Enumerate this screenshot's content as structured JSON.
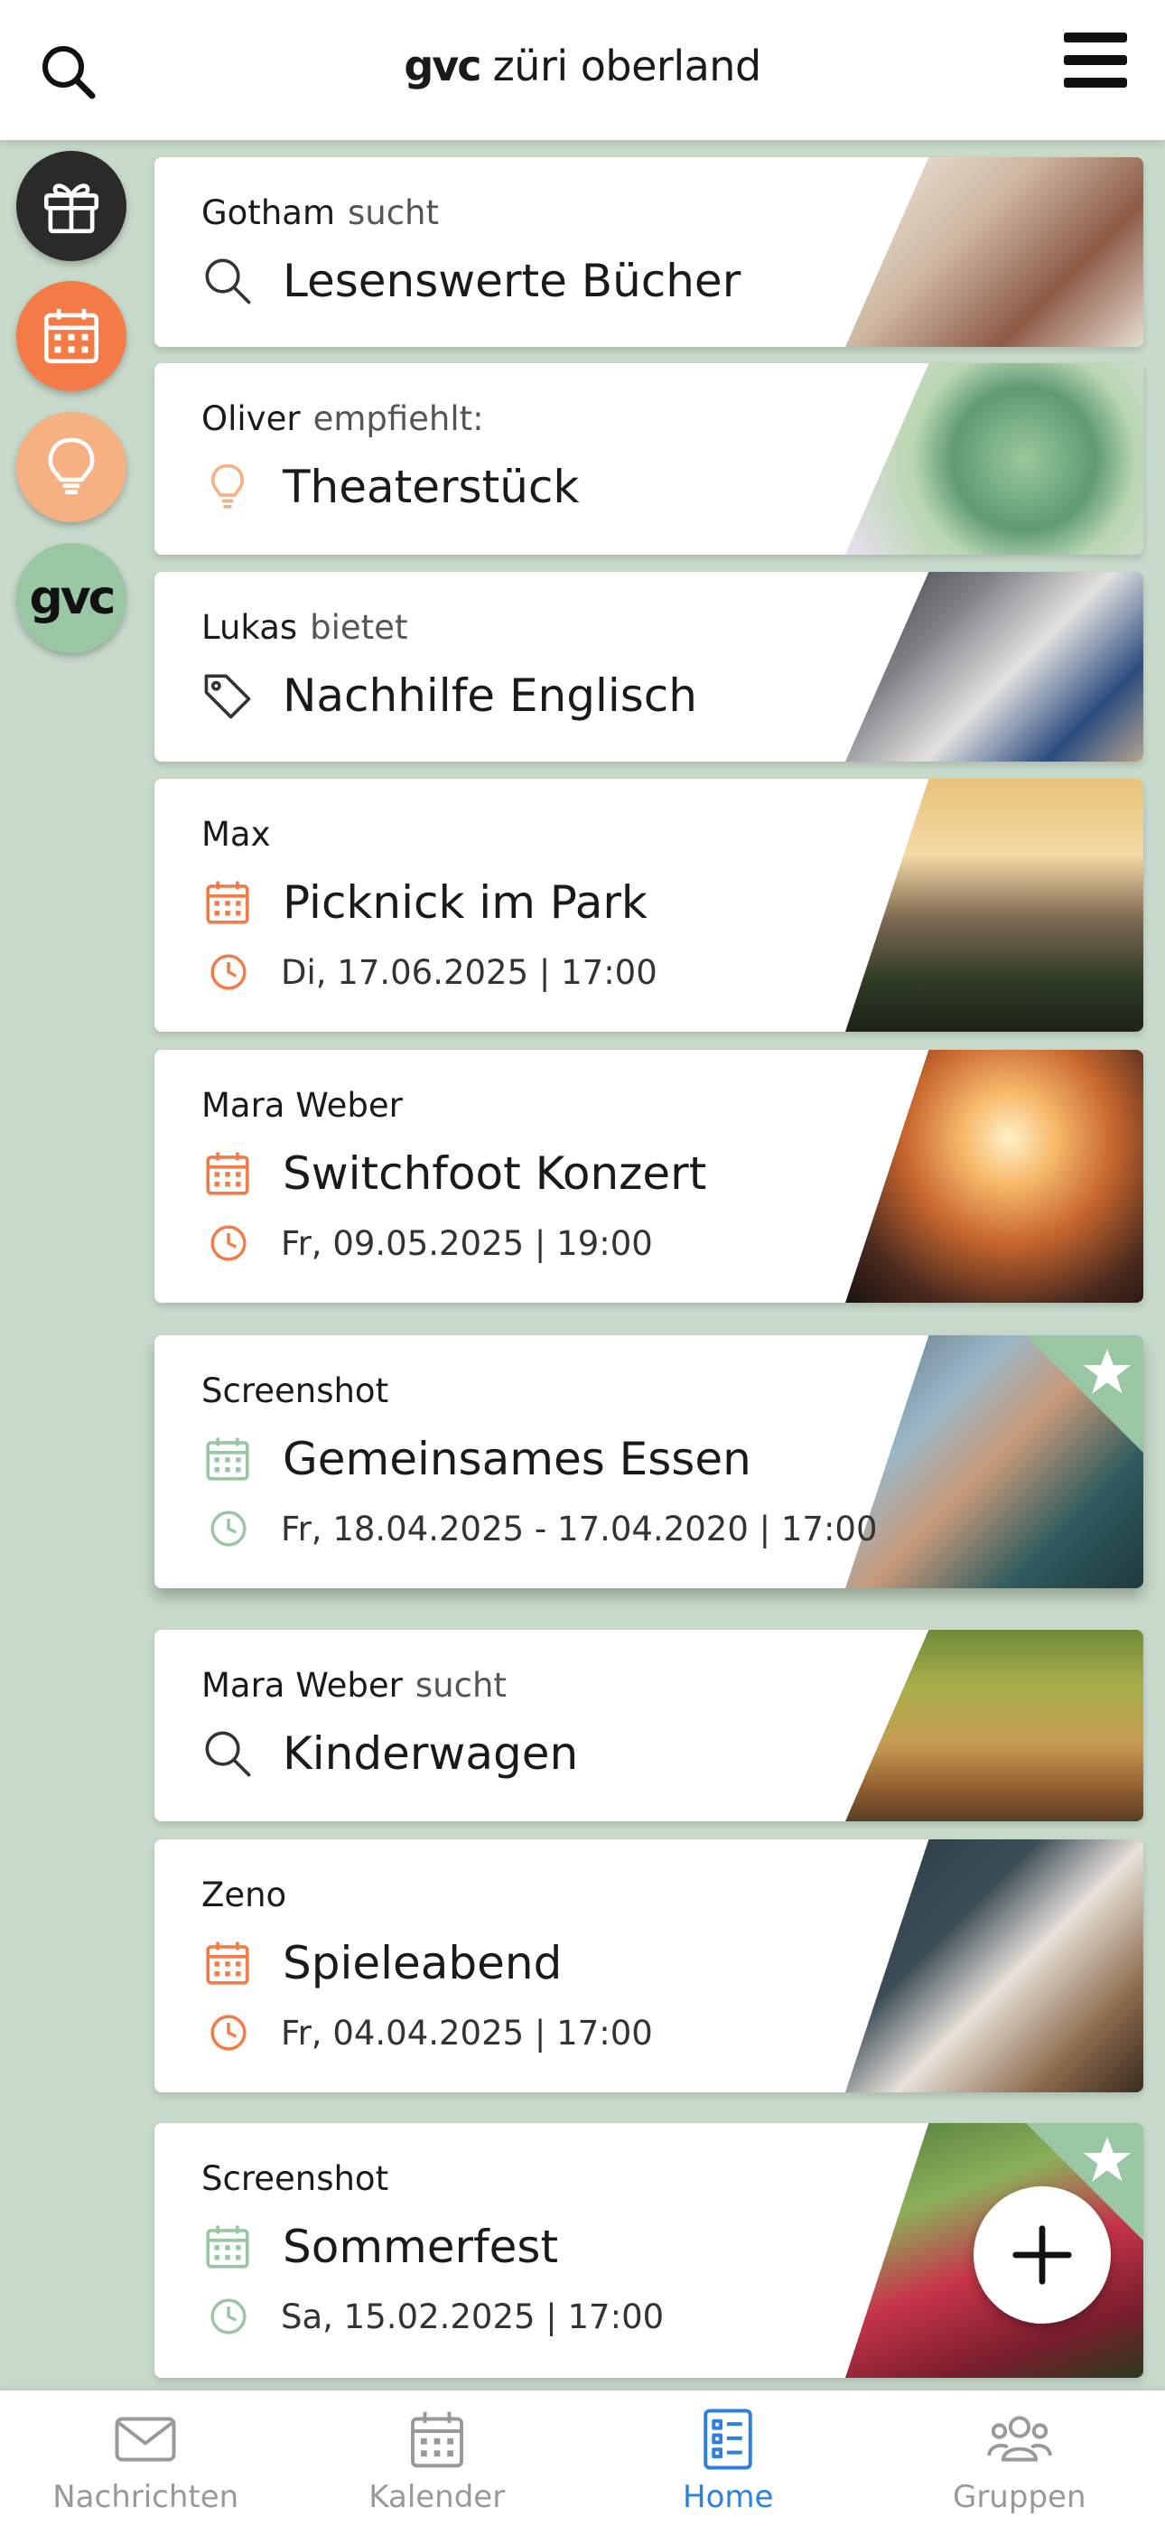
{
  "header": {
    "logo_brand": "gvc",
    "logo_text": "züri oberland",
    "search_icon": "search-icon",
    "menu_icon": "hamburger-menu-icon"
  },
  "side_buttons": [
    {
      "icon": "gift-icon",
      "color": "#2a2a2a"
    },
    {
      "icon": "calendar-icon",
      "color": "#f47b45"
    },
    {
      "icon": "lightbulb-icon",
      "color": "#f6b183"
    },
    {
      "icon": "gvc-logo",
      "label": "gvc",
      "color": "#99c7a4"
    }
  ],
  "cards": [
    {
      "author": "Gotham",
      "verb": "sucht",
      "icon": "search-icon",
      "title": "Lesenswerte Bücher"
    },
    {
      "author": "Oliver",
      "verb": "empfiehlt:",
      "icon": "lightbulb-icon",
      "title": "Theaterstück"
    },
    {
      "author": "Lukas",
      "verb": "bietet",
      "icon": "tag-icon",
      "title": "Nachhilfe Englisch"
    },
    {
      "author": "Max",
      "icon": "calendar-icon",
      "title": "Picknick im Park",
      "date": "Di, 17.06.2025 | 17:00"
    },
    {
      "author": "Mara Weber",
      "icon": "calendar-icon",
      "title": "Switchfoot Konzert",
      "date": "Fr, 09.05.2025 | 19:00"
    },
    {
      "author": "Screenshot",
      "icon": "calendar-icon",
      "title": "Gemeinsames Essen",
      "date": "Fr, 18.04.2025 - 17.04.2020 | 17:00",
      "starred": true
    },
    {
      "author": "Mara Weber",
      "verb": "sucht",
      "icon": "search-icon",
      "title": "Kinderwagen"
    },
    {
      "author": "Zeno",
      "icon": "calendar-icon",
      "title": "Spieleabend",
      "date": "Fr, 04.04.2025 | 17:00"
    },
    {
      "author": "Screenshot",
      "icon": "calendar-icon",
      "title": "Sommerfest",
      "date": "Sa, 15.02.2025 | 17:00",
      "starred": true
    }
  ],
  "fab": {
    "icon": "plus-icon"
  },
  "bottom_nav": [
    {
      "icon": "mail-icon",
      "label": "Nachrichten"
    },
    {
      "icon": "calendar-icon",
      "label": "Kalender"
    },
    {
      "icon": "list-icon",
      "label": "Home",
      "active": true
    },
    {
      "icon": "group-icon",
      "label": "Gruppen"
    }
  ],
  "colors": {
    "background": "#c8dacb",
    "orange": "#f47b45",
    "light_orange": "#f6b183",
    "green": "#99c7a4",
    "active_blue": "#2d7fe0"
  }
}
